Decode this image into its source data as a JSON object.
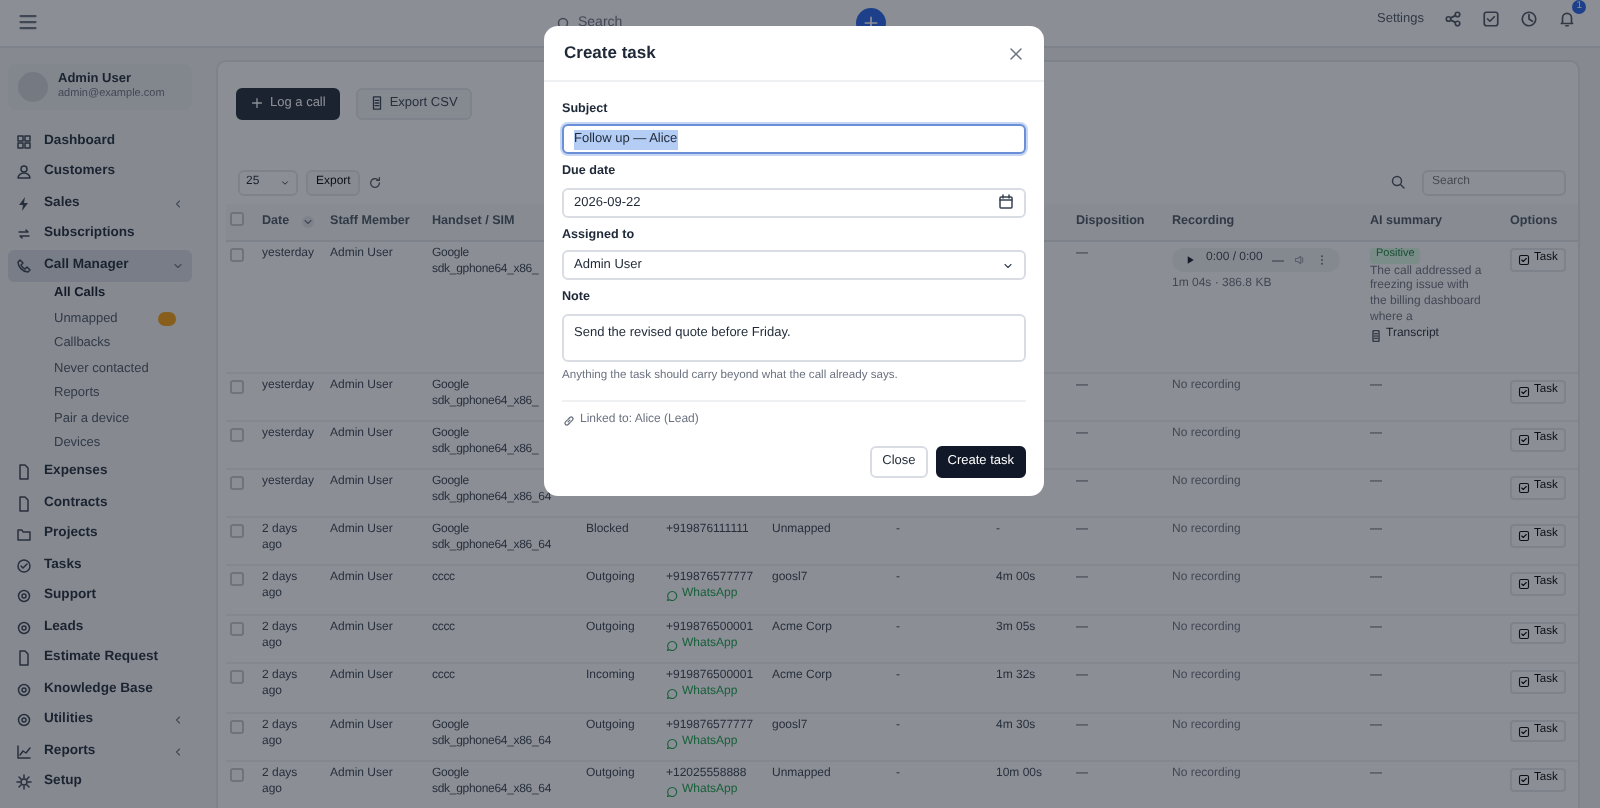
{
  "header": {
    "search_placeholder": "Search",
    "settings": "Settings",
    "notifications": "1"
  },
  "sidebar": {
    "user": {
      "name": "Admin User",
      "email": "admin@example.com"
    },
    "items": [
      {
        "label": "Dashboard",
        "selected": false
      },
      {
        "label": "Customers",
        "selected": false
      },
      {
        "label": "Sales",
        "selected": false,
        "expanded": false
      },
      {
        "label": "Subscriptions",
        "selected": false
      },
      {
        "label": "Call Manager",
        "selected": true,
        "expanded": true,
        "children": [
          {
            "label": "All Calls",
            "selected": true
          },
          {
            "label": "Unmapped",
            "selected": false,
            "color": "#875e1b"
          },
          {
            "label": "Callbacks",
            "selected": false
          },
          {
            "label": "Never contacted",
            "selected": false
          },
          {
            "label": "Reports",
            "selected": false
          },
          {
            "label": "Pair a device",
            "selected": false
          },
          {
            "label": "Devices",
            "selected": false
          }
        ]
      },
      {
        "label": "Expenses",
        "selected": false
      },
      {
        "label": "Contracts",
        "selected": false
      },
      {
        "label": "Projects",
        "selected": false
      },
      {
        "label": "Tasks",
        "selected": false
      },
      {
        "label": "Support",
        "selected": false
      },
      {
        "label": "Leads",
        "selected": false
      },
      {
        "label": "Estimate Request",
        "selected": false
      },
      {
        "label": "Knowledge Base",
        "selected": false
      },
      {
        "label": "Utilities",
        "selected": false,
        "expanded": false
      },
      {
        "label": "Reports",
        "selected": false,
        "expanded": false
      },
      {
        "label": "Setup",
        "selected": false
      }
    ]
  },
  "actions": [
    {
      "label": "Log a call",
      "kind": "primary"
    },
    {
      "label": "Export CSV",
      "kind": "secondary"
    }
  ],
  "table_controls": {
    "page_size": "25",
    "export": "Export",
    "search_placeholder": "Search"
  },
  "table": {
    "header_checked": false,
    "columns": [
      {
        "label": "Date",
        "sortable": true
      },
      {
        "label": "Staff Member",
        "sortable": false
      },
      {
        "label": "Handset / SIM",
        "sortable": false
      },
      null,
      null,
      null,
      null,
      null,
      {
        "label": "Disposition",
        "sortable": false
      },
      {
        "label": "Recording",
        "sortable": false
      },
      {
        "label": "AI summary",
        "sortable": false
      },
      {
        "label": "Options",
        "sortable": false
      }
    ],
    "rows": [
      {
        "checked": false,
        "date": "yesterday",
        "staff": "Admin User",
        "handset": "Google sdk_gphone64_x86_",
        "disposition": "—",
        "recording": {
          "kind": "player",
          "time": "0:00 / 0:00",
          "meta": "1m 04s · 386.8 KB"
        },
        "ai": {
          "sentiment": "Positive",
          "summary": "The call addressed a freezing issue with the billing dashboard where a",
          "link": "Transcript"
        },
        "option": "Task"
      },
      {
        "checked": false,
        "date": "yesterday",
        "staff": "Admin User",
        "handset": "Google sdk_gphone64_x86_",
        "disposition": "—",
        "recording": {
          "kind": "none",
          "text": "No recording"
        },
        "ai_text": "—",
        "option": "Task"
      },
      {
        "checked": false,
        "date": "yesterday",
        "staff": "Admin User",
        "handset": "Google sdk_gphone64_x86_",
        "disposition": "—",
        "recording": {
          "kind": "none",
          "text": "No recording"
        },
        "ai_text": "—",
        "option": "Task"
      },
      {
        "checked": false,
        "date": "yesterday",
        "staff": "Admin User",
        "handset": "Google sdk_gphone64_x86_64",
        "disposition": "—",
        "recording": {
          "kind": "none",
          "text": "No recording"
        },
        "ai_text": "—",
        "option": "Task"
      },
      {
        "checked": false,
        "date": "2 days ago",
        "staff": "Admin User",
        "handset": "Google sdk_gphone64_x86_64",
        "type": "Blocked",
        "number": "+919876111111",
        "customer": "Unmapped",
        "column_8": "-",
        "duration": "-",
        "disposition": "—",
        "recording": {
          "kind": "none",
          "text": "No recording"
        },
        "ai_text": "—",
        "option": "Task"
      },
      {
        "checked": false,
        "date": "2 days ago",
        "staff": "Admin User",
        "handset": "cccc",
        "type": "Outgoing",
        "number": "+919876577777",
        "whatsapp": "WhatsApp",
        "customer": "goosl7",
        "column_8": "-",
        "duration": "4m 00s",
        "disposition": "—",
        "recording": {
          "kind": "none",
          "text": "No recording"
        },
        "ai_text": "—",
        "option": "Task"
      },
      {
        "checked": false,
        "date": "2 days ago",
        "staff": "Admin User",
        "handset": "cccc",
        "type": "Outgoing",
        "number": "+919876500001",
        "whatsapp": "WhatsApp",
        "customer": "Acme Corp",
        "column_8": "-",
        "duration": "3m 05s",
        "disposition": "—",
        "recording": {
          "kind": "none",
          "text": "No recording"
        },
        "ai_text": "—",
        "option": "Task"
      },
      {
        "checked": false,
        "date": "2 days ago",
        "staff": "Admin User",
        "handset": "cccc",
        "type": "Incoming",
        "number": "+919876500001",
        "whatsapp": "WhatsApp",
        "customer": "Acme Corp",
        "column_8": "-",
        "duration": "1m 32s",
        "disposition": "—",
        "recording": {
          "kind": "none",
          "text": "No recording"
        },
        "ai_text": "—",
        "option": "Task"
      },
      {
        "checked": false,
        "date": "2 days ago",
        "staff": "Admin User",
        "handset": "Google sdk_gphone64_x86_64",
        "type": "Outgoing",
        "number": "+919876577777",
        "whatsapp": "WhatsApp",
        "customer": "goosl7",
        "column_8": "-",
        "duration": "4m 30s",
        "disposition": "—",
        "recording": {
          "kind": "none",
          "text": "No recording"
        },
        "ai_text": "—",
        "option": "Task"
      },
      {
        "checked": false,
        "date": "2 days ago",
        "staff": "Admin User",
        "handset": "Google sdk_gphone64_x86_64",
        "type": "Outgoing",
        "number": "+12025558888",
        "whatsapp": "WhatsApp",
        "customer": "Unmapped",
        "column_8": "-",
        "duration": "10m 00s",
        "disposition": "—",
        "recording": {
          "kind": "none",
          "text": "No recording"
        },
        "ai_text": "—",
        "option": "Task"
      }
    ]
  },
  "modal": {
    "title": "Create task",
    "fields": [
      {
        "kind": "text",
        "label": "Subject",
        "value": "Follow up — Alice",
        "focused": true
      },
      {
        "kind": "date",
        "label": "Due date",
        "value": "2026-09-22",
        "focused": false
      },
      {
        "kind": "select",
        "label": "Assigned to",
        "value": "Admin User",
        "focused": false
      },
      {
        "kind": "textarea",
        "label": "Note",
        "value": "Send the revised quote before Friday.",
        "focused": false,
        "help": "Anything the task should carry beyond what the call already says."
      }
    ],
    "linked": "Linked to: Alice (Lead)",
    "buttons": [
      {
        "label": "Close",
        "kind": "secondary"
      },
      {
        "label": "Create task",
        "kind": "primary"
      }
    ]
  }
}
